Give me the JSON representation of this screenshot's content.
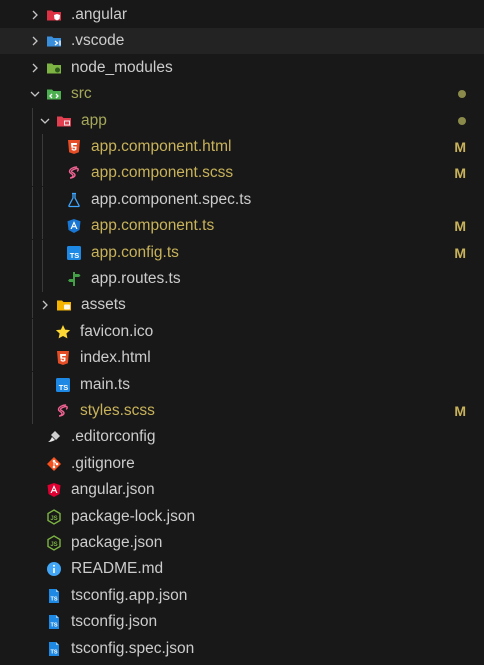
{
  "tree": [
    {
      "name": ".angular",
      "kind": "folder",
      "icon": "angular-folder-icon",
      "color": "#dd3344"
    },
    {
      "name": ".vscode",
      "kind": "folder",
      "icon": "vscode-folder-icon",
      "color": "#3b8fdc"
    },
    {
      "name": "node_modules",
      "kind": "folder",
      "icon": "node-folder-icon",
      "color": "#7cb342"
    },
    {
      "name": "src",
      "kind": "folder",
      "icon": "src-folder-icon",
      "expanded": true,
      "status": "dot",
      "color": "#4caf50"
    },
    {
      "name": "app",
      "kind": "folder",
      "icon": "app-folder-icon",
      "expanded": true,
      "status": "dot",
      "color": "#e0404f"
    },
    {
      "name": "app.component.html",
      "kind": "file",
      "icon": "html5-icon",
      "status": "M"
    },
    {
      "name": "app.component.scss",
      "kind": "file",
      "icon": "sass-icon",
      "status": "M"
    },
    {
      "name": "app.component.spec.ts",
      "kind": "file",
      "icon": "test-flask-icon"
    },
    {
      "name": "app.component.ts",
      "kind": "file",
      "icon": "angular-component-icon",
      "status": "M"
    },
    {
      "name": "app.config.ts",
      "kind": "file",
      "icon": "typescript-icon",
      "status": "M"
    },
    {
      "name": "app.routes.ts",
      "kind": "file",
      "icon": "routing-icon"
    },
    {
      "name": "assets",
      "kind": "folder",
      "icon": "assets-folder-icon",
      "color": "#f4b400"
    },
    {
      "name": "favicon.ico",
      "kind": "file",
      "icon": "star-icon"
    },
    {
      "name": "index.html",
      "kind": "file",
      "icon": "html5-icon"
    },
    {
      "name": "main.ts",
      "kind": "file",
      "icon": "typescript-icon"
    },
    {
      "name": "styles.scss",
      "kind": "file",
      "icon": "sass-icon",
      "status": "M"
    },
    {
      "name": ".editorconfig",
      "kind": "file",
      "icon": "editorconfig-icon"
    },
    {
      "name": ".gitignore",
      "kind": "file",
      "icon": "git-icon"
    },
    {
      "name": "angular.json",
      "kind": "file",
      "icon": "angular-icon"
    },
    {
      "name": "package-lock.json",
      "kind": "file",
      "icon": "nodejs-icon"
    },
    {
      "name": "package.json",
      "kind": "file",
      "icon": "nodejs-icon"
    },
    {
      "name": "README.md",
      "kind": "file",
      "icon": "info-icon"
    },
    {
      "name": "tsconfig.app.json",
      "kind": "file",
      "icon": "tsconfig-icon"
    },
    {
      "name": "tsconfig.json",
      "kind": "file",
      "icon": "tsconfig-icon"
    },
    {
      "name": "tsconfig.spec.json",
      "kind": "file",
      "icon": "tsconfig-icon"
    }
  ],
  "colors": {
    "background": "#181818",
    "text": "#cccccc",
    "modified": "#c8b25a",
    "untracked_dir": "#a5a85a",
    "selected_row": "#232323"
  },
  "selected": ".vscode"
}
